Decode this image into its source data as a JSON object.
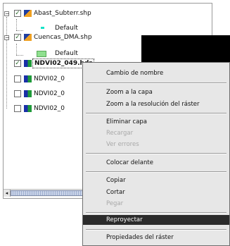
{
  "layers": [
    {
      "name": "Abast_Subterr.shp",
      "legend": "Default",
      "checked": true,
      "type": "vector",
      "expanded": true
    },
    {
      "name": "Cuencas_DMA.shp",
      "legend": "Default",
      "checked": true,
      "type": "vector",
      "expanded": true
    },
    {
      "name": "NDVI02_049.hdr",
      "checked": true,
      "type": "raster",
      "selected": true
    },
    {
      "name": "NDVI02_0",
      "checked": false,
      "type": "raster"
    },
    {
      "name": "NDVI02_0",
      "checked": false,
      "type": "raster"
    },
    {
      "name": "NDVI02_0",
      "checked": false,
      "type": "raster"
    }
  ],
  "context_menu": {
    "rename": "Cambio de nombre",
    "zoom_layer": "Zoom a la capa",
    "zoom_raster_res": "Zoom a la resolución del ráster",
    "remove_layer": "Eliminar capa",
    "reload": "Recargar",
    "view_errors": "Ver errores",
    "bring_front": "Colocar delante",
    "copy": "Copiar",
    "cut": "Cortar",
    "paste": "Pegar",
    "reproject": "Reproyectar",
    "raster_properties": "Propiedades del ráster"
  },
  "colors": {
    "legend_point": "#17e3c8",
    "legend_polygon": "#8fe08f",
    "menu_highlight": "#2b2b2b"
  },
  "icons": {
    "check": "✓",
    "expand_minus": "−",
    "scroll_left": "◂"
  }
}
